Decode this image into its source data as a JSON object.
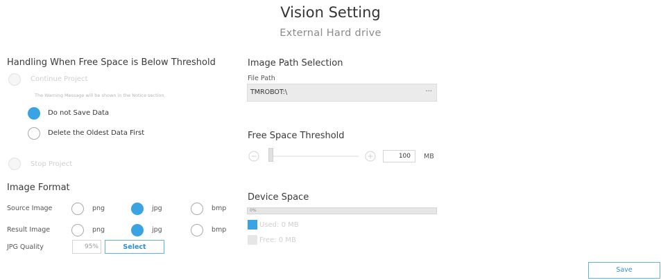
{
  "header": {
    "title": "Vision Setting",
    "subtitle": "External Hard drive"
  },
  "threshold_handling": {
    "heading": "Handling When Free Space is Below Threshold",
    "continue_label": "Continue Project",
    "warning_note": "The Warning Message will be shown in the Notice section.",
    "do_not_save_label": "Do not Save Data",
    "delete_oldest_label": "Delete the Oldest Data First",
    "stop_label": "Stop Project",
    "selected": "Do not Save Data"
  },
  "image_format": {
    "heading": "Image Format",
    "source_label": "Source Image",
    "result_label": "Result Image",
    "options": [
      "png",
      "jpg",
      "bmp"
    ],
    "source_selected": "jpg",
    "result_selected": "jpg",
    "jpg_quality_label": "JPG Quality",
    "jpg_quality_value": "95%",
    "select_button": "Select"
  },
  "image_path": {
    "heading": "Image Path Selection",
    "file_path_label": "File Path",
    "file_path_value": "TMROBOT:\\",
    "browse_button": "···"
  },
  "free_space": {
    "heading": "Free Space Threshold",
    "value": "100",
    "unit": "MB",
    "minus_icon": "minus-circle-icon",
    "plus_icon": "plus-circle-icon"
  },
  "device_space": {
    "heading": "Device Space",
    "usage_percent_text": "0%",
    "usage_fraction": 0,
    "used_label": "Used: 0 MB",
    "free_label": "Free: 0 MB",
    "used_color": "#3aa3e3",
    "free_color": "#e6e6e6"
  },
  "footer": {
    "save_button": "Save"
  }
}
